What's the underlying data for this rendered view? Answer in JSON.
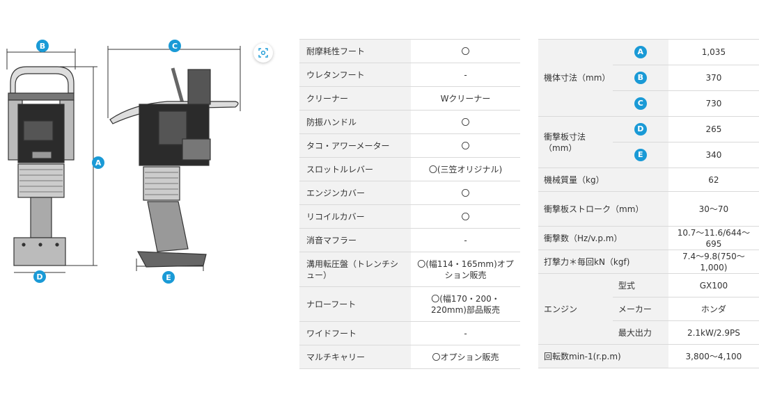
{
  "diagram": {
    "markers": [
      "A",
      "B",
      "C",
      "D",
      "E"
    ],
    "accent_color": "#1a9ad6",
    "zoom_icon": "zoom-icon"
  },
  "options": [
    {
      "label": "耐摩耗性フート",
      "value": "〇"
    },
    {
      "label": "ウレタンフート",
      "value": "-"
    },
    {
      "label": "クリーナー",
      "value": "Wクリーナー"
    },
    {
      "label": "防振ハンドル",
      "value": "〇"
    },
    {
      "label": "タコ・アワーメーター",
      "value": "〇"
    },
    {
      "label": "スロットルレバー",
      "value": "〇(三笠オリジナル)"
    },
    {
      "label": "エンジンカバー",
      "value": "〇"
    },
    {
      "label": "リコイルカバー",
      "value": "〇"
    },
    {
      "label": "消音マフラー",
      "value": "-"
    },
    {
      "label": "溝用転圧盤（トレンチシュー）",
      "value": "〇(幅114・165mm)オプション販売"
    },
    {
      "label": "ナローフート",
      "value": "〇(幅170・200・220mm)部品販売"
    },
    {
      "label": "ワイドフート",
      "value": "-"
    },
    {
      "label": "マルチキャリー",
      "value": "〇オプション販売"
    }
  ],
  "specs": {
    "body_dims_label": "機体寸法（mm）",
    "plate_dims_label": "衝撃板寸法（mm）",
    "dims": [
      {
        "badge": "A",
        "value": "1,035"
      },
      {
        "badge": "B",
        "value": "370"
      },
      {
        "badge": "C",
        "value": "730"
      },
      {
        "badge": "D",
        "value": "265"
      },
      {
        "badge": "E",
        "value": "340"
      }
    ],
    "mass_label": "機械質量（kg）",
    "mass_value": "62",
    "stroke_label": "衝撃板ストローク（mm）",
    "stroke_value": "30〜70",
    "impacts_label": "衝撃数（Hz/v.p.m）",
    "impacts_value": "10.7〜11.6/644〜695",
    "force_label": "打撃力＊毎回kN（kgf)",
    "force_value": "7.4〜9.8(750〜1,000)",
    "engine_label": "エンジン",
    "engine_rows": [
      {
        "label": "型式",
        "value": "GX100"
      },
      {
        "label": "メーカー",
        "value": "ホンダ"
      },
      {
        "label": "最大出力",
        "value": "2.1kW/2.9PS"
      }
    ],
    "rpm_label": "回転数min-1(r.p.m)",
    "rpm_value": "3,800〜4,100"
  }
}
